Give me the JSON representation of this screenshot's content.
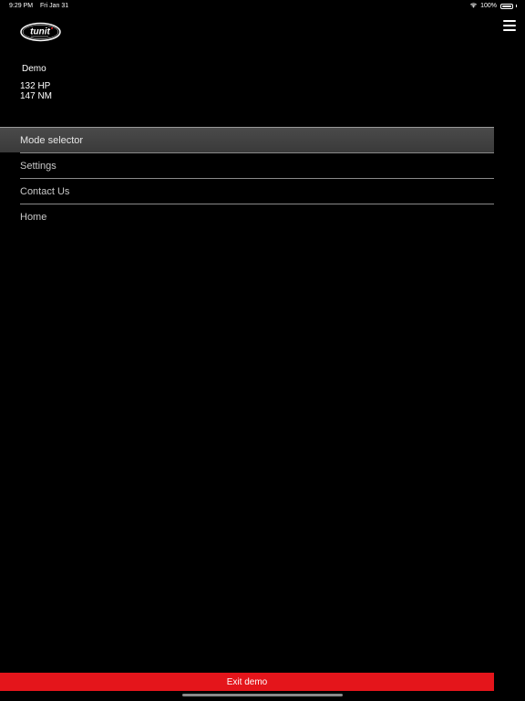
{
  "status_bar": {
    "time": "9:29 PM",
    "date": "Fri Jan 31",
    "battery": "100%",
    "battery_level": 1.0
  },
  "logo": {
    "text": "tunit"
  },
  "car": {
    "name": "Demo",
    "hp": "132 HP",
    "nm": "147 NM"
  },
  "menu": {
    "items": [
      {
        "label": "Mode selector",
        "active": true
      },
      {
        "label": "Settings",
        "active": false
      },
      {
        "label": "Contact Us",
        "active": false
      },
      {
        "label": "Home",
        "active": false
      }
    ]
  },
  "exit_demo": {
    "label": "Exit demo"
  },
  "colors": {
    "background": "#000000",
    "accent_red": "#e4151b",
    "active_item_bg": "#4a4a4a",
    "divider": "#8a8a8a"
  },
  "icons": {
    "wifi": "wifi-icon",
    "battery": "battery-icon",
    "menu": "hamburger-menu-icon"
  }
}
